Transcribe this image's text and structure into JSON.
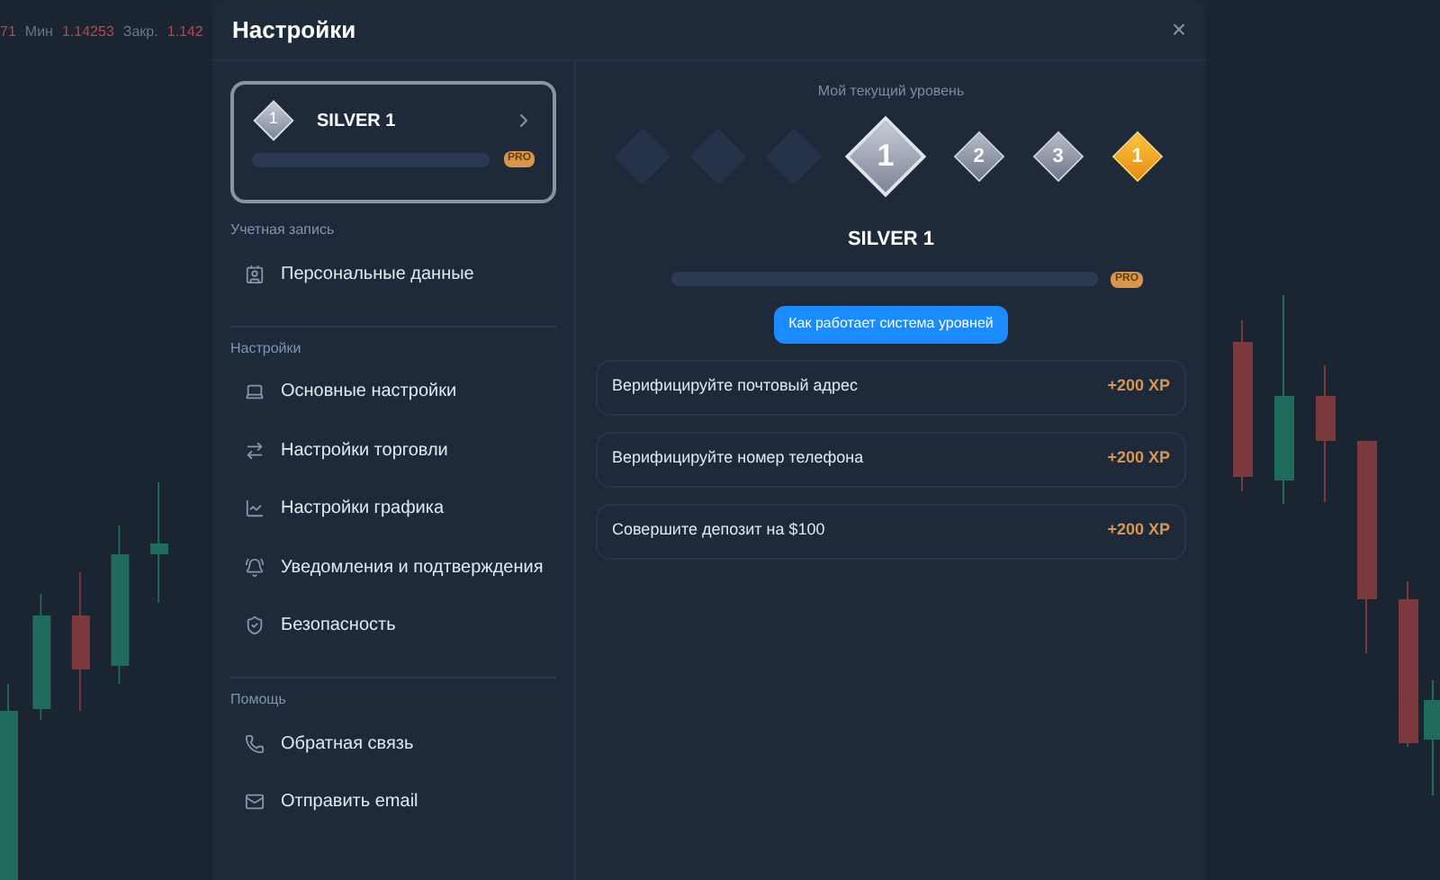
{
  "ticker": [
    "71",
    "Мин",
    "1.14253",
    "Закр.",
    "1.142"
  ],
  "dialog": {
    "title": "Настройки",
    "close": "×"
  },
  "level_card": {
    "badge": "1",
    "name": "SILVER 1",
    "pro": "PRO",
    "level": 0
  },
  "sidebar": [
    {
      "title": "Учетная запись",
      "items": [
        "Персональные данные"
      ]
    },
    {
      "title": "Настройки",
      "items": [
        "Основные настройки",
        "Настройки торговли",
        "Настройки графика",
        "Уведомления и подтверждения",
        "Безопасность"
      ]
    },
    {
      "title": "Помощь",
      "items": [
        "Обратная связь",
        "Отправить email"
      ]
    }
  ],
  "levels": {
    "caption": "Мой текущий уровень",
    "badges": [
      {
        "kind": "empty"
      },
      {
        "kind": "empty"
      },
      {
        "kind": "empty"
      },
      {
        "kind": "current",
        "label": "1"
      },
      {
        "kind": "silver",
        "label": "2"
      },
      {
        "kind": "silver",
        "label": "3"
      },
      {
        "kind": "gold",
        "label": "1"
      }
    ],
    "name": "SILVER 1",
    "pro": "PRO",
    "level": 0,
    "button": "Как работает система уровней"
  },
  "tasks": [
    {
      "label": "Верифицируйте почтовый адрес",
      "reward": "+200 XP"
    },
    {
      "label": "Верифицируйте номер телефона",
      "reward": "+200 XP"
    },
    {
      "label": "Совершите депозит на $100",
      "reward": "+200 XP"
    }
  ]
}
